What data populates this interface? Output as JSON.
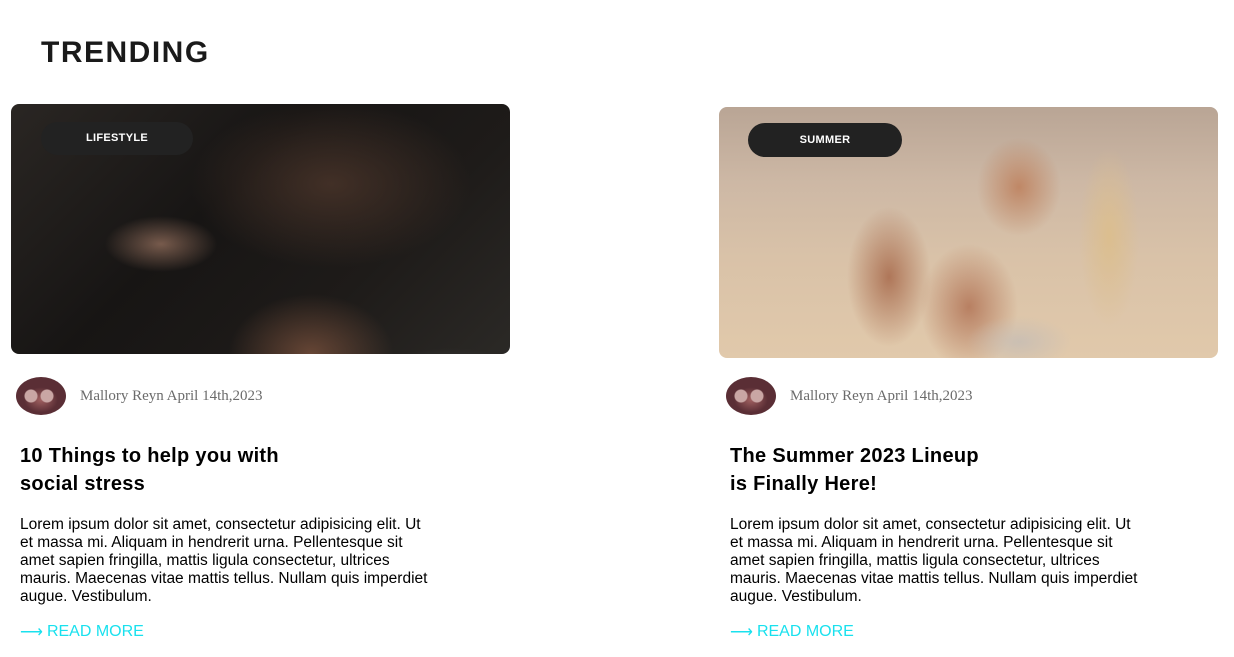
{
  "section": {
    "title": "TRENDING"
  },
  "cards": [
    {
      "tag": "LIFESTYLE",
      "meta": "Mallory Reyn April 14th,2023",
      "title_line1": "10 Things to help you with",
      "title_line2": "social stress",
      "body": "Lorem ipsum dolor sit amet, consectetur adipisicing elit. Ut et massa mi. Aliquam in hendrerit urna. Pellentesque sit amet sapien fringilla, mattis ligula consectetur, ultrices mauris. Maecenas vitae mattis tellus. Nullam quis imperdiet augue. Vestibulum.",
      "read_more_arrow": "⟶",
      "read_more_label": "READ MORE"
    },
    {
      "tag": "SUMMER",
      "meta": "Mallory Reyn April 14th,2023",
      "title_line1": "The Summer 2023 Lineup",
      "title_line2": "is Finally Here!",
      "body": "Lorem ipsum dolor sit amet, consectetur adipisicing elit. Ut et massa mi. Aliquam in hendrerit urna. Pellentesque sit amet sapien fringilla, mattis ligula consectetur, ultrices mauris. Maecenas vitae mattis tellus. Nullam quis imperdiet augue. Vestibulum.",
      "read_more_arrow": "⟶",
      "read_more_label": "READ MORE"
    }
  ],
  "colors": {
    "accent": "#19e1ee",
    "tag_background": "#222222",
    "meta_text": "#6b6b6b"
  }
}
